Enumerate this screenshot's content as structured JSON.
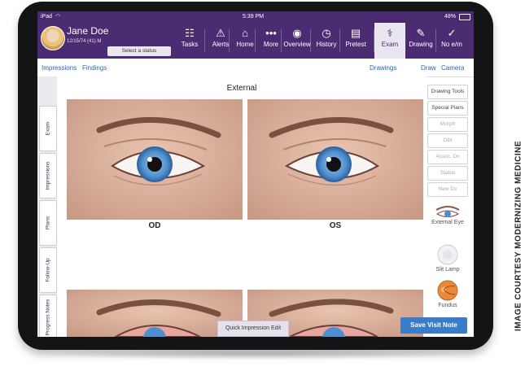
{
  "statusbar": {
    "device": "iPad",
    "wifi_icon": "wifi-icon",
    "time": "5:39 PM",
    "battery": "48%"
  },
  "patient": {
    "name": "Jane Doe",
    "info": "12/15/74 (41) M",
    "status_button": "Select a status"
  },
  "nav": [
    {
      "label": "Tasks",
      "icon": "☷"
    },
    {
      "label": "Alerts",
      "icon": "⚠"
    },
    {
      "label": "Home",
      "icon": "⌂"
    },
    {
      "label": "More",
      "icon": "•••"
    },
    {
      "label": "Overview",
      "icon": "◉"
    },
    {
      "label": "History",
      "icon": "◷"
    },
    {
      "label": "Pretest",
      "icon": "▤"
    },
    {
      "label": "Exam",
      "icon": "⚕"
    },
    {
      "label": "Drawing",
      "icon": "✎"
    },
    {
      "label": "No e/m",
      "icon": "✓"
    }
  ],
  "subnav": {
    "impressions": "Impressions",
    "findings": "Findings",
    "drawings": "Drawings",
    "draw": "Draw",
    "camera": "Camera"
  },
  "side_tabs": [
    "Exam",
    "Impressions",
    "Plans",
    "Follow-Up",
    "Progress Notes"
  ],
  "main": {
    "title": "External",
    "od_label": "OD",
    "os_label": "OS"
  },
  "right_panel": {
    "buttons": [
      "Drawing Tools",
      "Special Plans",
      "Morph",
      "Ddx",
      "Assoc. Dx",
      "Status",
      "New Dx"
    ],
    "tools": [
      "External Eye",
      "Slit Lamp",
      "Fundus"
    ]
  },
  "footer": {
    "quick_impression": "Quick Impression Edit",
    "save": "Save Visit Note"
  },
  "credit": "IMAGE COURTESY MODERNIZING MEDICINE",
  "colors": {
    "nav_bg": "#4b2c72",
    "save_button": "#3a7cc8",
    "link": "#2a66b8"
  }
}
